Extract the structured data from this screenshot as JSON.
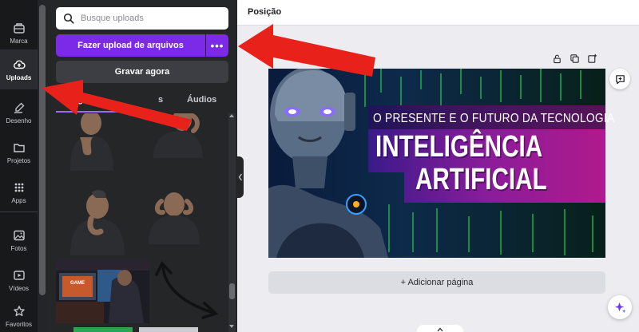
{
  "sidebar": {
    "items": [
      {
        "label": "Marca",
        "icon": "brand-icon"
      },
      {
        "label": "Uploads",
        "icon": "cloud-upload-icon"
      },
      {
        "label": "Desenho",
        "icon": "draw-icon"
      },
      {
        "label": "Projetos",
        "icon": "folder-icon"
      },
      {
        "label": "Apps",
        "icon": "apps-grid-icon"
      },
      {
        "label": "Fotos",
        "icon": "photo-icon"
      },
      {
        "label": "Vídeos",
        "icon": "video-icon"
      },
      {
        "label": "Favoritos",
        "icon": "star-icon"
      }
    ],
    "active": "Uploads"
  },
  "panel": {
    "search_placeholder": "Busque uploads",
    "upload_label": "Fazer upload de arquivos",
    "more_label": "•••",
    "record_label": "Gravar agora",
    "tabs": [
      {
        "label": "Imagens",
        "visible_text": "agens",
        "active": true
      },
      {
        "label": "Vídeos",
        "visible_text": "s",
        "active": false
      },
      {
        "label": "Áudios",
        "visible_text": "Áudios",
        "active": false
      }
    ]
  },
  "editor": {
    "title": "Posição",
    "add_page_label": "+ Adicionar página",
    "banner": {
      "line1": "O PRESENTE E O FUTURO DA TECNOLOGIA",
      "line2": "INTELIGÊNCIA",
      "line3": "ARTIFICIAL"
    }
  },
  "colors": {
    "accent": "#7d2ae8",
    "annotation_arrow": "#e8221b",
    "rail_bg": "#18191b",
    "panel_bg": "#252627",
    "canvas_bg": "#ececf1"
  }
}
